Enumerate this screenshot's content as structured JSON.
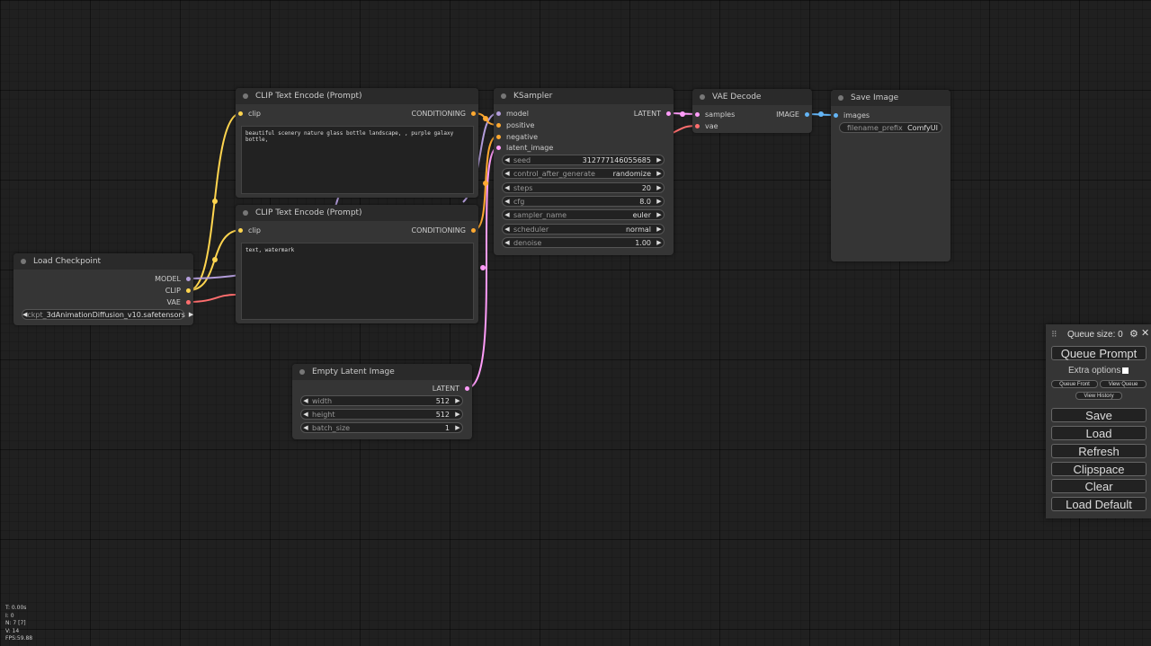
{
  "nodes": {
    "clip1": {
      "title": "CLIP Text Encode (Prompt)",
      "input": "clip",
      "output": "CONDITIONING",
      "text": "beautiful scenery nature glass bottle landscape, , purple galaxy bottle,"
    },
    "clip2": {
      "title": "CLIP Text Encode (Prompt)",
      "input": "clip",
      "output": "CONDITIONING",
      "text": "text, watermark"
    },
    "ksampler": {
      "title": "KSampler",
      "inputs": [
        "model",
        "positive",
        "negative",
        "latent_image"
      ],
      "output": "LATENT",
      "widgets": [
        {
          "label": "seed",
          "value": "312777146055685"
        },
        {
          "label": "control_after_generate",
          "value": "randomize"
        },
        {
          "label": "steps",
          "value": "20"
        },
        {
          "label": "cfg",
          "value": "8.0"
        },
        {
          "label": "sampler_name",
          "value": "euler"
        },
        {
          "label": "scheduler",
          "value": "normal"
        },
        {
          "label": "denoise",
          "value": "1.00"
        }
      ]
    },
    "vae_decode": {
      "title": "VAE Decode",
      "inputs": [
        "samples",
        "vae"
      ],
      "output": "IMAGE"
    },
    "save_image": {
      "title": "Save Image",
      "input": "images",
      "widget": {
        "label": "filename_prefix",
        "value": "ComfyUI"
      }
    },
    "checkpoint": {
      "title": "Load Checkpoint",
      "outputs": [
        "MODEL",
        "CLIP",
        "VAE"
      ],
      "widget": {
        "label": "ckpt_",
        "value": "3dAnimationDiffusion_v10.safetensors"
      }
    },
    "latent": {
      "title": "Empty Latent Image",
      "output": "LATENT",
      "widgets": [
        {
          "label": "width",
          "value": "512"
        },
        {
          "label": "height",
          "value": "512"
        },
        {
          "label": "batch_size",
          "value": "1"
        }
      ]
    }
  },
  "menu": {
    "queue_size": "Queue size: 0",
    "queue_prompt": "Queue Prompt",
    "extra_options": "Extra options",
    "queue_front": "Queue Front",
    "view_queue": "View Queue",
    "view_history": "View History",
    "save": "Save",
    "load": "Load",
    "refresh": "Refresh",
    "clipspace": "Clipspace",
    "clear": "Clear",
    "load_default": "Load Default"
  },
  "stats": {
    "t": "T: 0.00s",
    "i": "I: 0",
    "n": "N: 7 [7]",
    "v": "V: 14",
    "fps": "FPS:59.88"
  },
  "colors": {
    "model": "#b39ddb",
    "clip": "#ffd54f",
    "vae": "#ff6e6e",
    "conditioning": "#ffa931",
    "latent": "#ff9cf9",
    "image": "#64b5f6"
  }
}
